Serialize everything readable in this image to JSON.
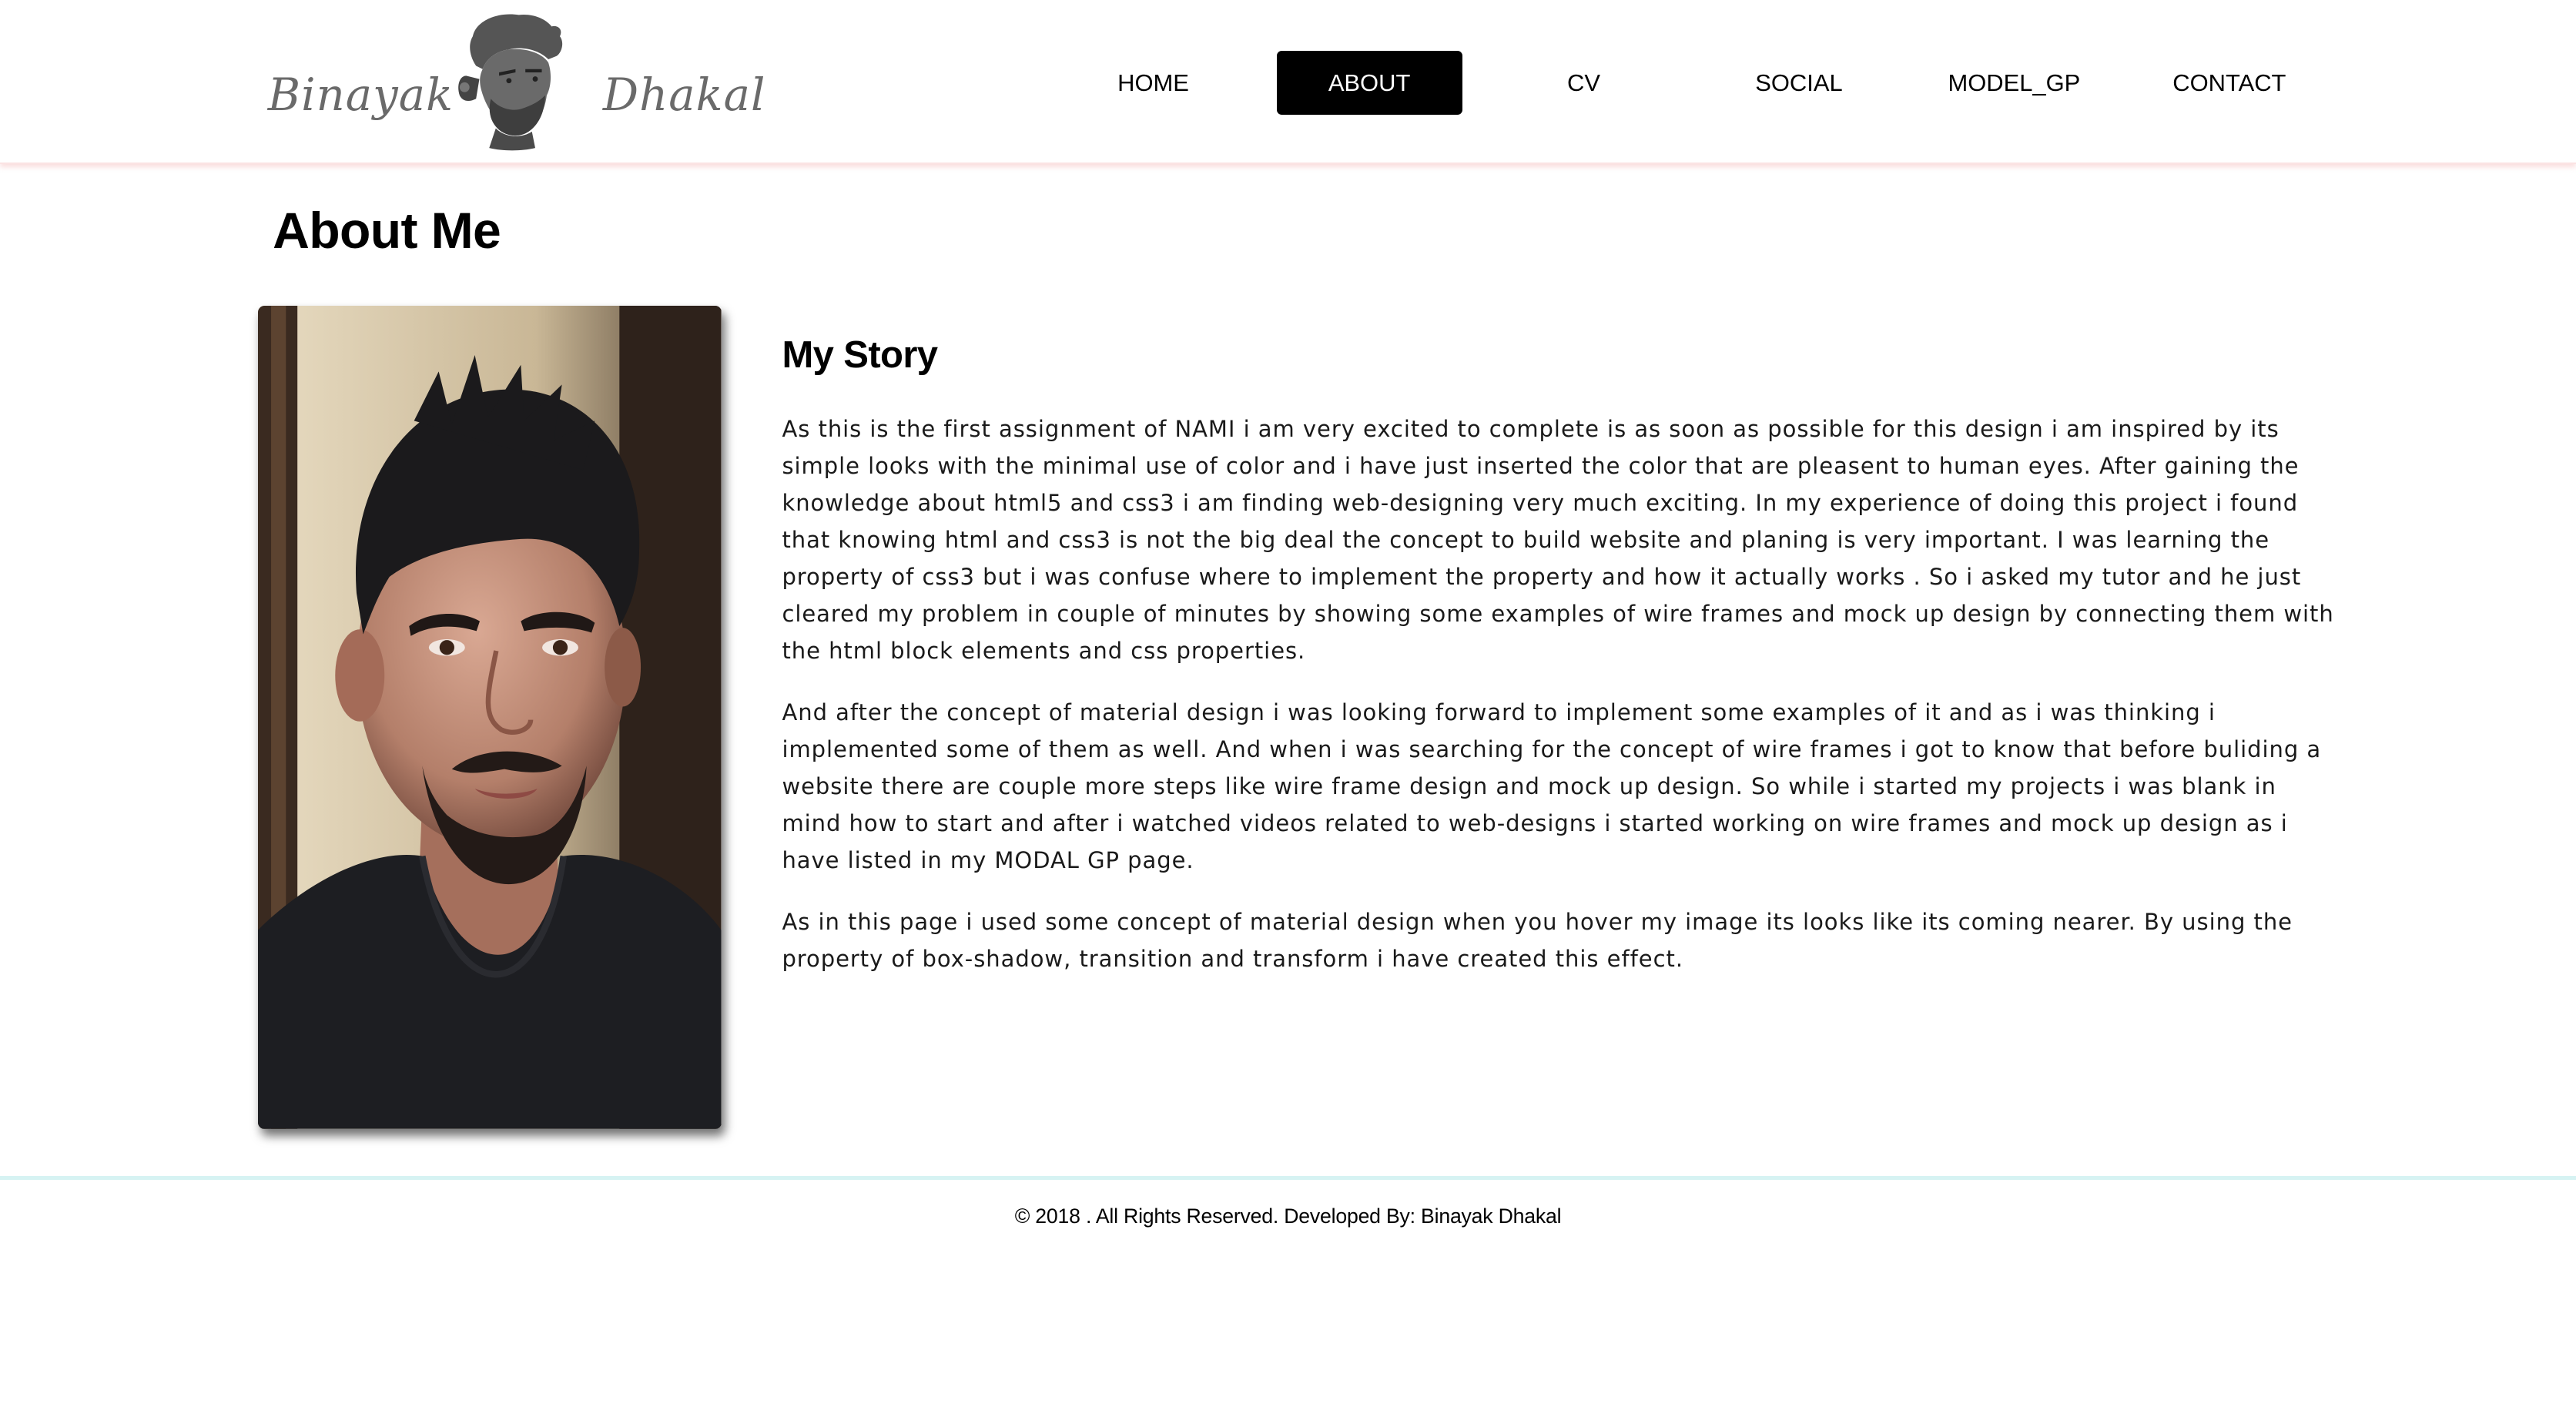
{
  "header": {
    "logo": {
      "first_name": "Binayak",
      "last_name": "Dhakal",
      "icon": "portrait-silhouette-icon"
    },
    "nav": [
      {
        "label": "HOME",
        "active": false
      },
      {
        "label": "ABOUT",
        "active": true
      },
      {
        "label": "CV",
        "active": false
      },
      {
        "label": "SOCIAL",
        "active": false
      },
      {
        "label": "MODEL_GP",
        "active": false
      },
      {
        "label": "CONTACT",
        "active": false
      }
    ]
  },
  "main": {
    "title": "About Me",
    "photo": "profile-photo",
    "story": {
      "heading": "My Story",
      "paragraphs": [
        "As this is the first assignment of NAMI i am very excited to complete is as soon as possible for this design i am inspired by its simple looks with the minimal use of color and i have just inserted the color that are pleasent to human eyes. After gaining the knowledge about html5 and css3 i am finding web-designing very much exciting. In my experience of doing this project i found that knowing html and css3 is not the big deal the concept to build website and planing is very important. I was learning the property of css3 but i was confuse where to implement the property and how it actually works . So i asked my tutor and he just cleared my problem in couple of minutes by showing some examples of wire frames and mock up design by connecting them with the html block elements and css properties.",
        "And after the concept of material design i was looking forward to implement some examples of it and as i was thinking i implemented some of them as well. And when i was searching for the concept of wire frames i got to know that before buliding a website there are couple more steps like wire frame design and mock up design. So while i started my projects i was blank in mind how to start and after i watched videos related to web-designs i started working on wire frames and mock up design as i have listed in my MODAL GP page.",
        "As in this page i used some concept of material design when you hover my image its looks like its coming nearer. By using the property of box-shadow, transition and transform i have created this effect."
      ]
    }
  },
  "footer": {
    "text": "© 2018 . All Rights Reserved. Developed By: Binayak Dhakal"
  },
  "colors": {
    "active_nav_bg": "#000000",
    "header_shadow": "#f0a0a0",
    "footer_rule": "#d6f3f3"
  }
}
